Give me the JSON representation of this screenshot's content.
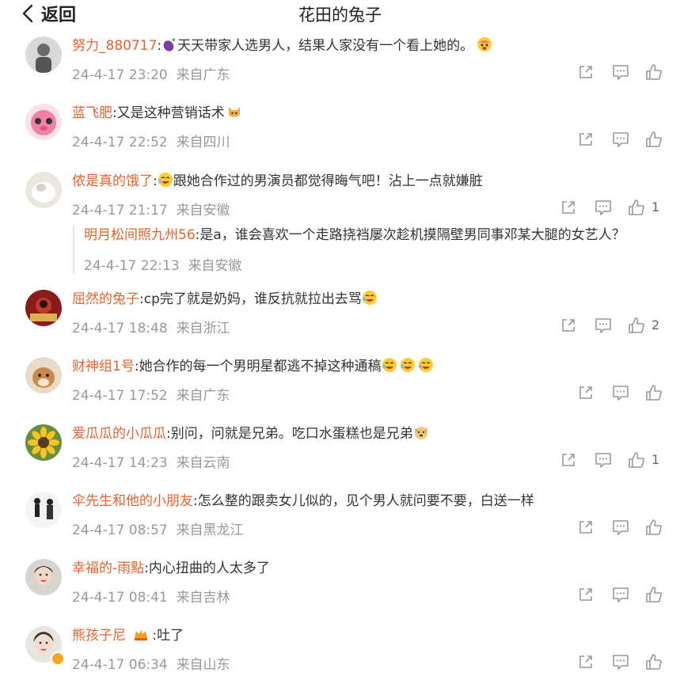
{
  "header": {
    "back_label": "返回",
    "title": "花田的兔子"
  },
  "comments": [
    {
      "user": "努力_880717",
      "text": "天天带家人选男人，结果人家没有一个看上她的。",
      "time": "24-4-17 23:20",
      "location": "来自广东",
      "likes": ""
    },
    {
      "user": "蓝飞肥",
      "text": "又是这种营销话术",
      "time": "24-4-17 22:52",
      "location": "来自四川",
      "likes": ""
    },
    {
      "user": "侬是真的饿了",
      "text": "跟她合作过的男演员都觉得晦气吧！沾上一点就嫌脏",
      "time": "24-4-17 21:17",
      "location": "来自安徽",
      "likes": "1",
      "reply": {
        "user": "明月松间照九州56",
        "text": "是a，谁会喜欢一个走路挠裆屡次趁机摸隔壁男同事邓某大腿的女艺人？",
        "time": "24-4-17 22:13",
        "location": "来自安徽"
      }
    },
    {
      "user": "屈然的兔子",
      "text": "cp完了就是奶妈，谁反抗就拉出去骂",
      "time": "24-4-17 18:48",
      "location": "来自浙江",
      "likes": "2"
    },
    {
      "user": "财神组1号",
      "text": "她合作的每一个男明星都逃不掉这种通稿",
      "time": "24-4-17 17:52",
      "location": "来自广东",
      "likes": ""
    },
    {
      "user": "爱瓜瓜的小瓜瓜",
      "text": "别问，问就是兄弟。吃口水蛋糕也是兄弟",
      "time": "24-4-17 14:23",
      "location": "来自云南",
      "likes": "1"
    },
    {
      "user": "伞先生和他的小朋友",
      "text": "怎么整的跟卖女儿似的，见个男人就问要不要，白送一样",
      "time": "24-4-17 08:57",
      "location": "来自黑龙江",
      "likes": ""
    },
    {
      "user": "幸福的-雨點",
      "text": "内心扭曲的人太多了",
      "time": "24-4-17 08:41",
      "location": "来自吉林",
      "likes": ""
    },
    {
      "user": "熊孩子尼",
      "text": "吐了",
      "time": "24-4-17 06:34",
      "location": "来自山东",
      "likes": ""
    }
  ],
  "icons": [
    "back-chevron-icon",
    "share-icon",
    "comment-icon",
    "like-icon",
    "eggplant-emoji",
    "cat-emoji",
    "crying-emoji",
    "laughing-emoji",
    "dog-emoji",
    "crown-badge"
  ],
  "colors": {
    "username": "#e8622d",
    "meta": "#999999",
    "text": "#333333"
  }
}
